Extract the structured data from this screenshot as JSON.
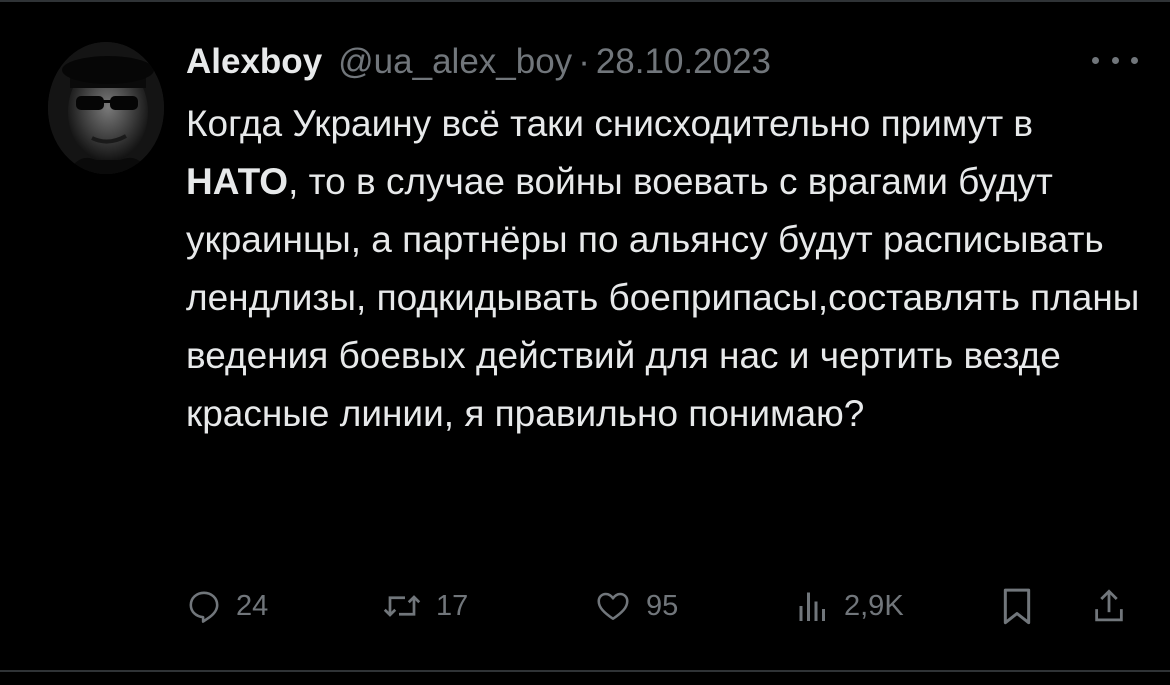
{
  "tweet": {
    "author": {
      "display_name": "Alexboy",
      "handle": "@ua_alex_boy"
    },
    "separator": "·",
    "date": "28.10.2023",
    "text_parts": {
      "before_bold": "Когда Украину всё таки снисходительно примут в ",
      "bold": "НАТО",
      "after_bold": ", то  в случае войны воевать с врагами будут украинцы, а партнёры по альянсу будут расписывать лендлизы, подкидывать боеприпасы,составлять планы ведения боевых действий для нас и чертить везде красные линии, я правильно понимаю?"
    }
  },
  "actions": {
    "replies": "24",
    "reposts": "17",
    "likes": "95",
    "views": "2,9K"
  },
  "icons": {
    "more": "more-dots-icon",
    "reply": "reply-icon",
    "repost": "repost-icon",
    "like": "heart-icon",
    "views": "views-chart-icon",
    "bookmark": "bookmark-icon",
    "share": "share-icon"
  },
  "colors": {
    "background": "#000000",
    "text": "#e7e9ea",
    "muted": "#71767b",
    "border": "#2f3336"
  }
}
